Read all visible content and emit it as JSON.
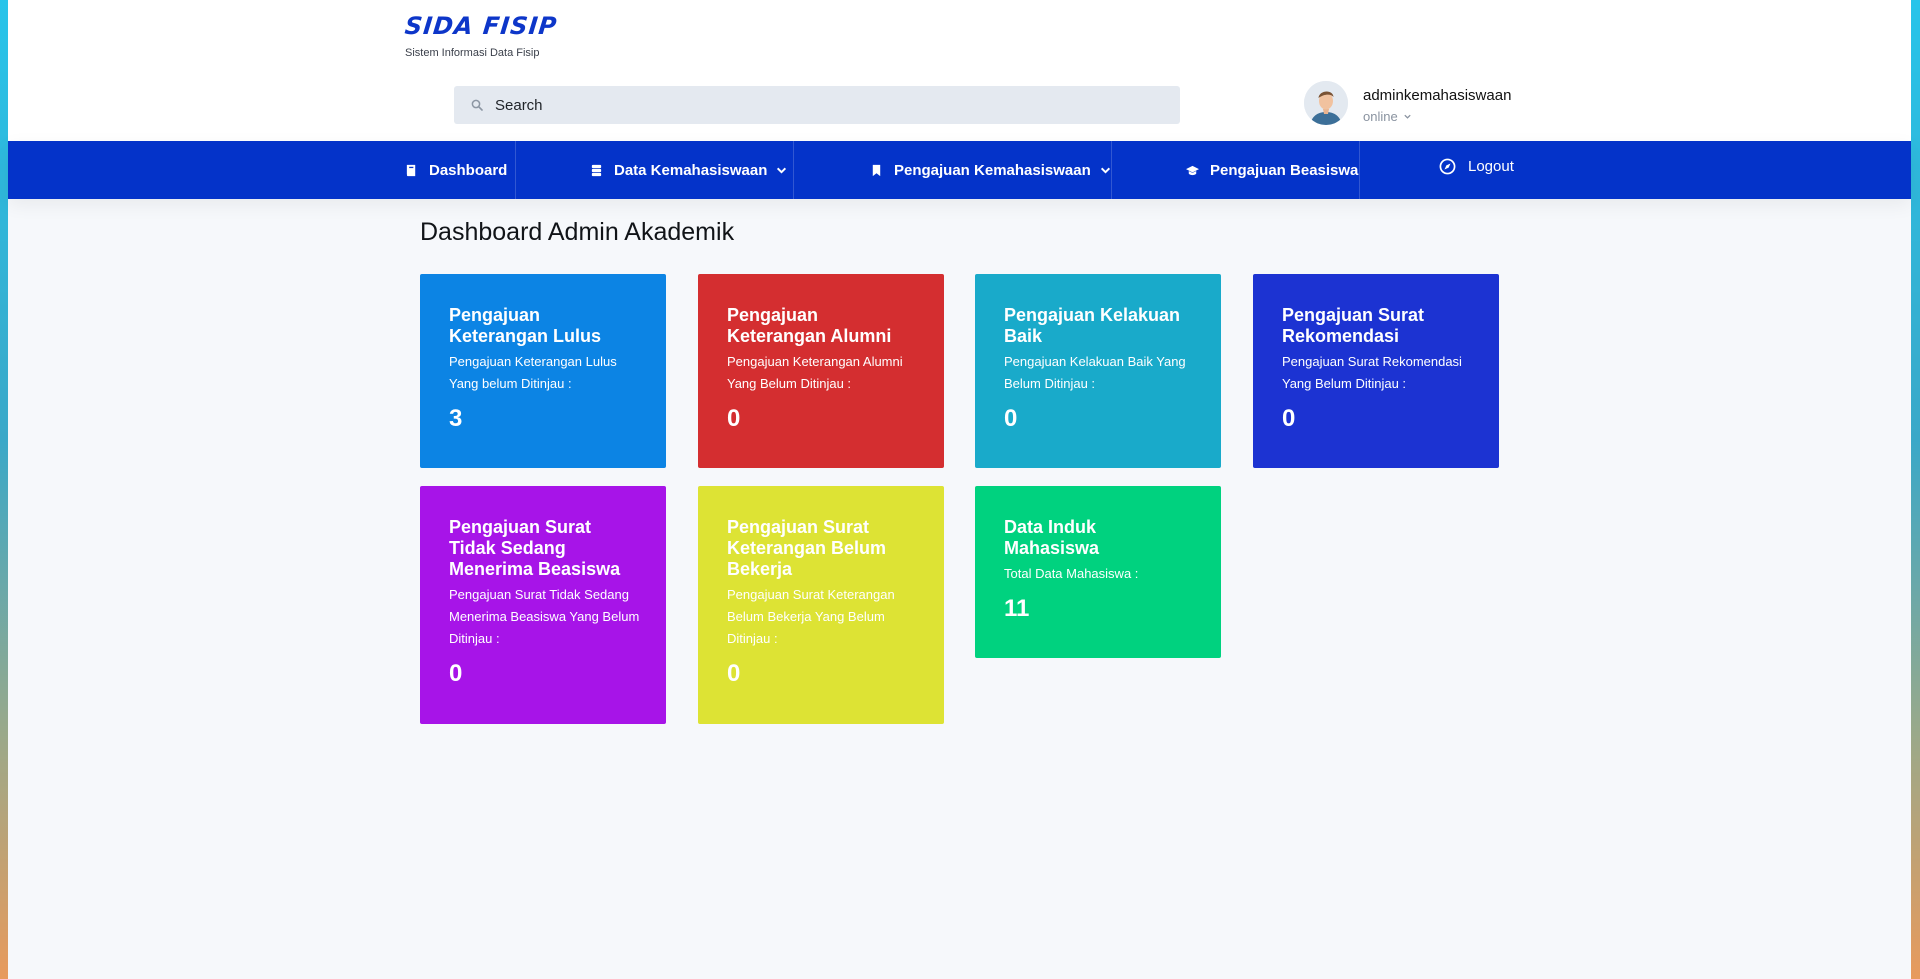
{
  "app": {
    "logo_title": "SIDA FISIP",
    "logo_subtitle": "Sistem Informasi Data Fisip"
  },
  "search": {
    "placeholder": "Search"
  },
  "user": {
    "name": "adminkemahasiswaan",
    "status": "online"
  },
  "nav": {
    "dashboard": "Dashboard",
    "data_kemahasiswaan": "Data Kemahasiswaan",
    "pengajuan_kemahasiswaan": "Pengajuan Kemahasiswaan",
    "pengajuan_beasiswa": "Pengajuan Beasiswa",
    "logout": "Logout"
  },
  "page_title": "Dashboard Admin Akademik",
  "cards": [
    {
      "title": "Pengajuan Keterangan Lulus",
      "desc": "Pengajuan Keterangan Lulus Yang belum Ditinjau :",
      "count": "3",
      "color": "#0c84e4"
    },
    {
      "title": "Pengajuan Keterangan Alumni",
      "desc": "Pengajuan Keterangan Alumni Yang Belum Ditinjau :",
      "count": "0",
      "color": "#d42e30"
    },
    {
      "title": "Pengajuan Kelakuan Baik",
      "desc": "Pengajuan Kelakuan Baik Yang Belum Ditinjau :",
      "count": "0",
      "color": "#19aaca"
    },
    {
      "title": "Pengajuan Surat Rekomendasi",
      "desc": "Pengajuan Surat Rekomendasi Yang Belum Ditinjau :",
      "count": "0",
      "color": "#1c33d2"
    },
    {
      "title": "Pengajuan Surat Tidak Sedang Menerima Beasiswa",
      "desc": "Pengajuan Surat Tidak Sedang Menerima Beasiswa Yang Belum Ditinjau :",
      "count": "0",
      "color": "#a714e8"
    },
    {
      "title": "Pengajuan Surat Keterangan Belum Bekerja",
      "desc": "Pengajuan Surat Keterangan Belum Bekerja Yang Belum Ditinjau :",
      "count": "0",
      "color": "#dde334"
    },
    {
      "title": "Data Induk Mahasiswa",
      "desc": "Total Data Mahasiswa :",
      "count": "11",
      "color": "#00d27f"
    }
  ],
  "icons": {
    "search": "search-icon",
    "dashboard": "book-icon",
    "data_kemahasiswaan": "database-icon",
    "pengajuan_kemahasiswaan": "bookmark-icon",
    "pengajuan_beasiswa": "graduation-cap-icon",
    "logout": "compass-icon",
    "dropdown": "chevron-down-icon"
  },
  "colors": {
    "brand": "#0433c9",
    "page_bg": "#f6f8fb"
  }
}
